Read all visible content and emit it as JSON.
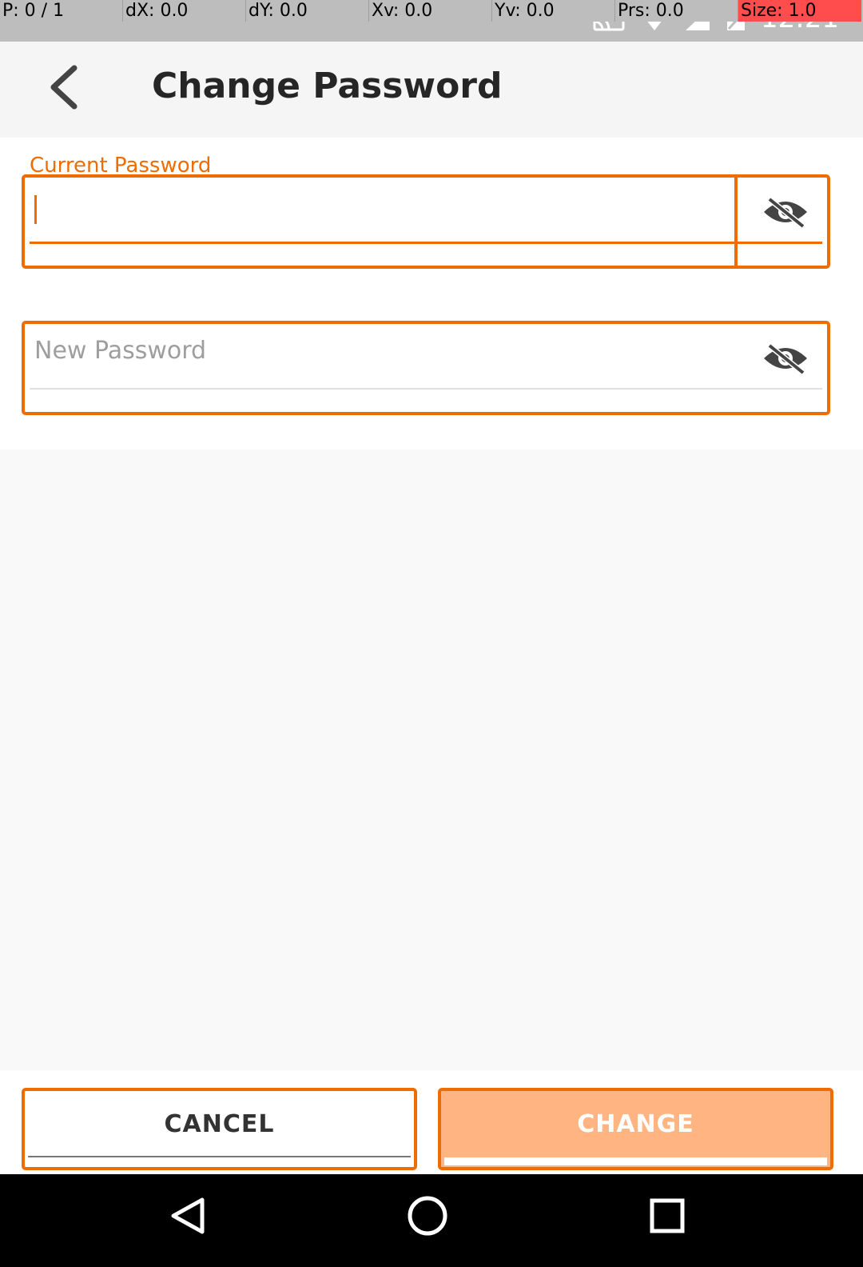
{
  "debug_bar": {
    "pointer": "P: 0 / 1",
    "dx": "dX: 0.0",
    "dy": "dY: 0.0",
    "xv": "Xv: 0.0",
    "yv": "Yv: 0.0",
    "prs": "Prs: 0.0",
    "size": "Size: 1.0"
  },
  "status_bar": {
    "time": "12:21",
    "icons": [
      "cast-icon",
      "wifi-icon",
      "signal-icon",
      "battery-icon"
    ]
  },
  "app_bar": {
    "title": "Change Password",
    "back_icon": "chevron-left-icon"
  },
  "form": {
    "current_password": {
      "label": "Current Password",
      "value": "",
      "toggle_icon": "eye-off-icon"
    },
    "new_password": {
      "placeholder": "New Password",
      "value": "",
      "toggle_icon": "eye-off-icon"
    }
  },
  "actions": {
    "cancel_label": "CANCEL",
    "change_label": "CHANGE"
  },
  "colors": {
    "accent": "#ef6c00",
    "change_button_bg": "#ffb482",
    "title_text": "#262626"
  },
  "nav_bar": {
    "buttons": [
      "back-triangle-icon",
      "home-circle-icon",
      "recents-square-icon"
    ]
  }
}
